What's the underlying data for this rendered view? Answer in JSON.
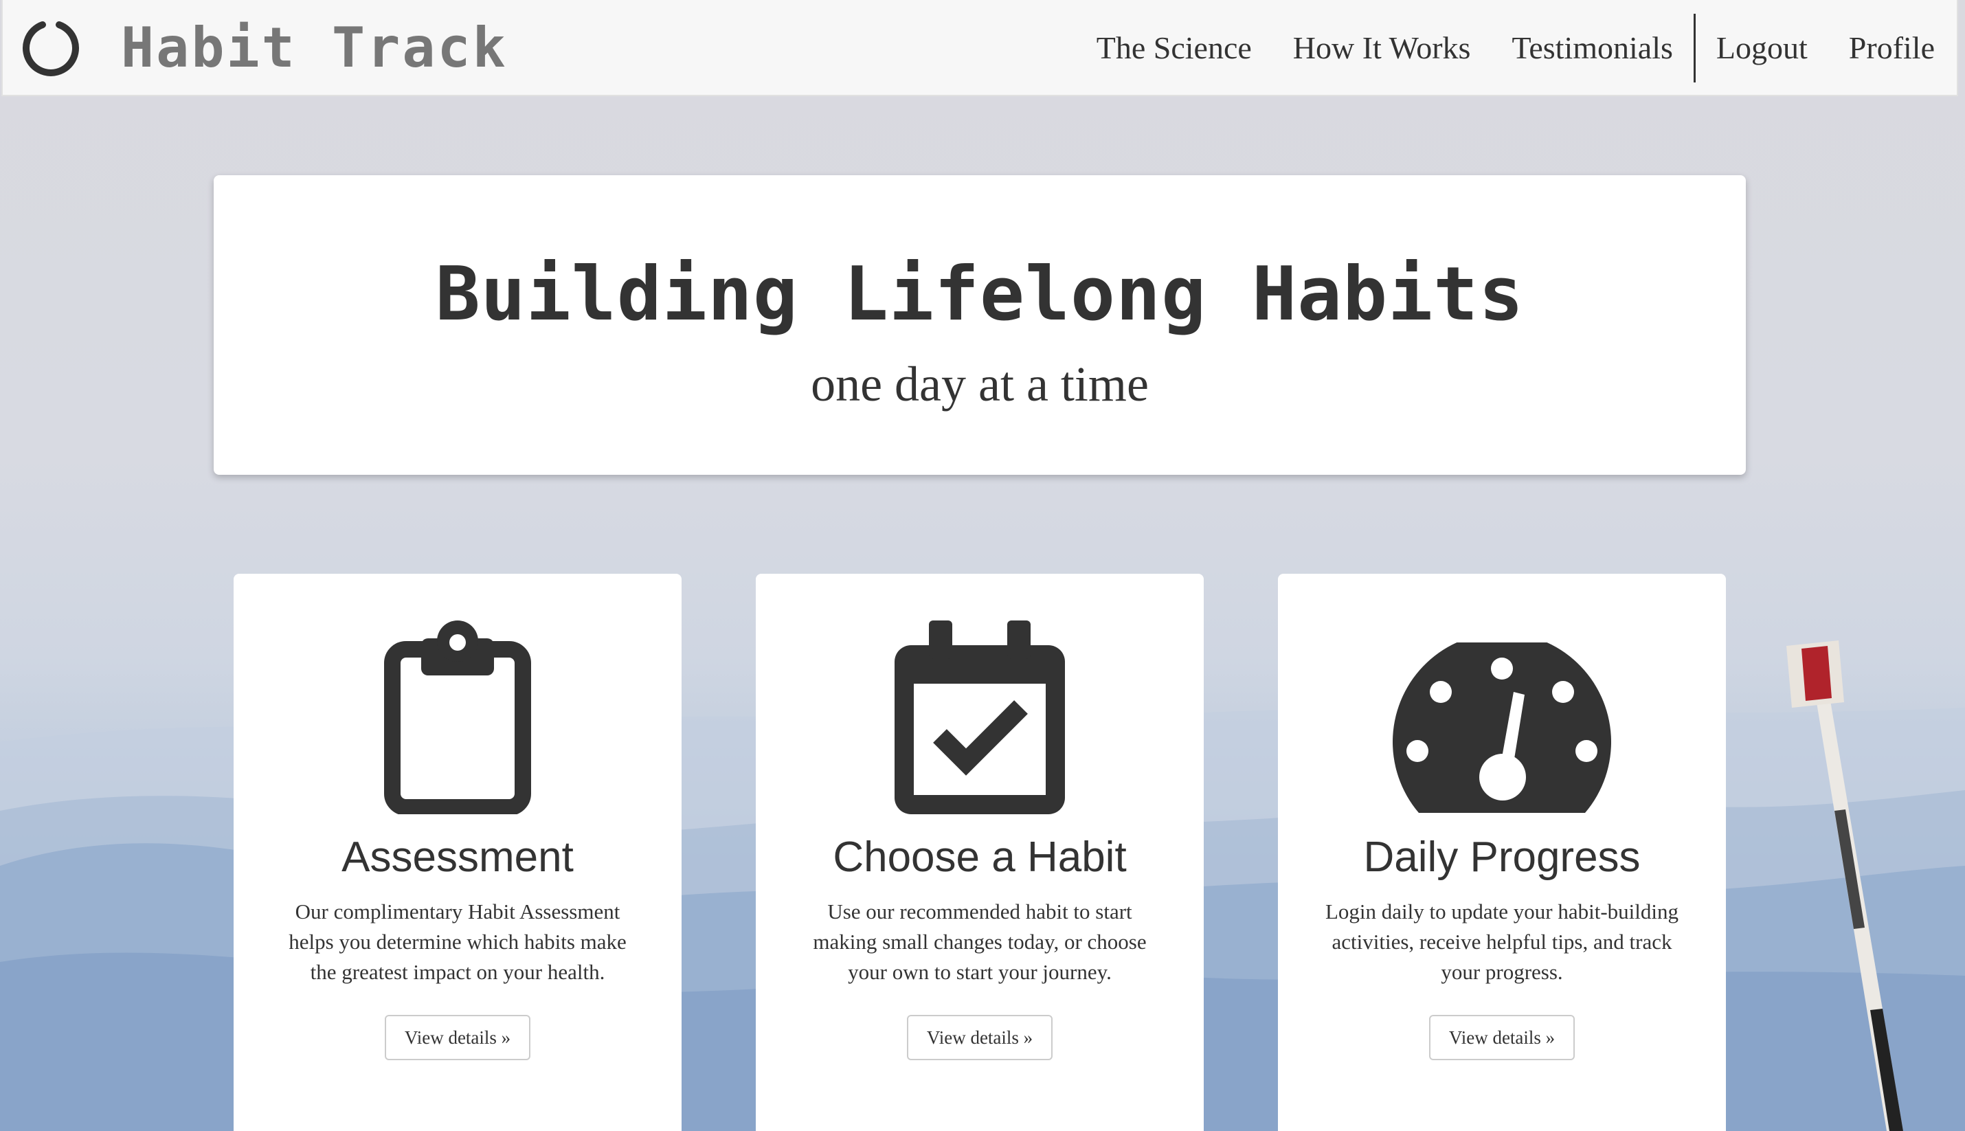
{
  "navbar": {
    "brand": "Habit Track",
    "links": [
      {
        "label": "The Science"
      },
      {
        "label": "How It Works"
      },
      {
        "label": "Testimonials"
      },
      {
        "label": "Logout"
      },
      {
        "label": "Profile"
      }
    ]
  },
  "hero": {
    "title": "Building Lifelong Habits",
    "subtitle": "one day at a time"
  },
  "cards": [
    {
      "icon": "clipboard-icon",
      "title": "Assessment",
      "text": "Our complimentary Habit Assessment helps you determine which habits make the greatest impact on your health.",
      "button": "View details »"
    },
    {
      "icon": "calendar-check-icon",
      "title": "Choose a Habit",
      "text": "Use our recommended habit to start making small changes today, or choose your own to start your journey.",
      "button": "View details »"
    },
    {
      "icon": "dashboard-gauge-icon",
      "title": "Daily Progress",
      "text": "Login daily to update your habit-building activities, receive helpful tips, and track your progress.",
      "button": "View details »"
    }
  ],
  "colors": {
    "text": "#333333",
    "brand_text": "#777777",
    "navbar_bg": "#f7f7f7",
    "card_bg": "#ffffff"
  }
}
